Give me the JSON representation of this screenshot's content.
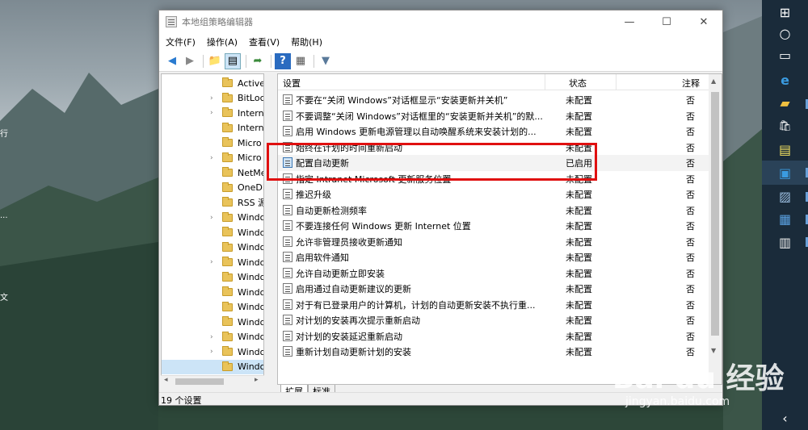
{
  "window": {
    "title": "本地组策略编辑器",
    "min_glyph": "—",
    "max_glyph": "☐",
    "close_glyph": "✕"
  },
  "menu": [
    "文件(F)",
    "操作(A)",
    "查看(V)",
    "帮助(H)"
  ],
  "toolbar": {
    "icons": [
      "back-icon",
      "forward-icon",
      "up-folder-icon",
      "show-hide-tree-icon",
      "export-list-icon",
      "help-icon",
      "properties-icon",
      "filter-icon"
    ],
    "glyphs": [
      "◀",
      "▶",
      "📁",
      "▤",
      "➦",
      "?",
      "▦",
      "▼"
    ]
  },
  "tree": {
    "items": [
      {
        "label": "Active",
        "expand": ""
      },
      {
        "label": "BitLoc",
        "expand": "›"
      },
      {
        "label": "Intern",
        "expand": "›"
      },
      {
        "label": "Intern",
        "expand": ""
      },
      {
        "label": "Micro",
        "expand": ""
      },
      {
        "label": "Micro",
        "expand": "›"
      },
      {
        "label": "NetMe",
        "expand": ""
      },
      {
        "label": "OneDi",
        "expand": ""
      },
      {
        "label": "RSS 源",
        "expand": ""
      },
      {
        "label": "Windo",
        "expand": "›"
      },
      {
        "label": "Windo",
        "expand": ""
      },
      {
        "label": "Windo",
        "expand": ""
      },
      {
        "label": "Windo",
        "expand": "›"
      },
      {
        "label": "Windo",
        "expand": ""
      },
      {
        "label": "Windo",
        "expand": ""
      },
      {
        "label": "Windo",
        "expand": ""
      },
      {
        "label": "Windo",
        "expand": ""
      },
      {
        "label": "Windo",
        "expand": "›"
      },
      {
        "label": "Windo",
        "expand": "›"
      },
      {
        "label": "Windo",
        "expand": ""
      }
    ],
    "selected_index": 19
  },
  "list": {
    "headers": {
      "setting": "设置",
      "state": "状态",
      "note": "注释"
    },
    "rows": [
      {
        "name": "不要在“关闭 Windows”对话框显示“安装更新并关机”",
        "state": "未配置",
        "note": "否",
        "enabled": false
      },
      {
        "name": "不要调整“关闭 Windows”对话框里的“安装更新并关机”的默...",
        "state": "未配置",
        "note": "否",
        "enabled": false
      },
      {
        "name": "启用 Windows 更新电源管理以自动唤醒系统来安装计划的...",
        "state": "未配置",
        "note": "否",
        "enabled": false
      },
      {
        "name": "始终在计划的时间重新启动",
        "state": "未配置",
        "note": "否",
        "enabled": false
      },
      {
        "name": "配置自动更新",
        "state": "已启用",
        "note": "否",
        "enabled": true
      },
      {
        "name": "指定 Intranet Microsoft 更新服务位置",
        "state": "未配置",
        "note": "否",
        "enabled": false
      },
      {
        "name": "推迟升级",
        "state": "未配置",
        "note": "否",
        "enabled": false
      },
      {
        "name": "自动更新检测频率",
        "state": "未配置",
        "note": "否",
        "enabled": false
      },
      {
        "name": "不要连接任何 Windows 更新 Internet 位置",
        "state": "未配置",
        "note": "否",
        "enabled": false
      },
      {
        "name": "允许非管理员接收更新通知",
        "state": "未配置",
        "note": "否",
        "enabled": false
      },
      {
        "name": "启用软件通知",
        "state": "未配置",
        "note": "否",
        "enabled": false
      },
      {
        "name": "允许自动更新立即安装",
        "state": "未配置",
        "note": "否",
        "enabled": false
      },
      {
        "name": "启用通过自动更新建议的更新",
        "state": "未配置",
        "note": "否",
        "enabled": false
      },
      {
        "name": "对于有已登录用户的计算机，计划的自动更新安装不执行重...",
        "state": "未配置",
        "note": "否",
        "enabled": false
      },
      {
        "name": "对计划的安装再次提示重新启动",
        "state": "未配置",
        "note": "否",
        "enabled": false
      },
      {
        "name": "对计划的安装延迟重新启动",
        "state": "未配置",
        "note": "否",
        "enabled": false
      },
      {
        "name": "重新计划自动更新计划的安装",
        "state": "未配置",
        "note": "否",
        "enabled": false
      }
    ],
    "highlighted_index": 4
  },
  "tabs": [
    "扩展",
    "标准"
  ],
  "status": "19 个设置",
  "desktop": {
    "left_labels": [
      "行",
      "...",
      "文"
    ]
  },
  "taskbar": {
    "icons": [
      "windows-start-icon",
      "cortana-icon",
      "task-view-icon",
      "edge-icon",
      "file-explorer-icon",
      "store-icon",
      "sticky-notes-icon",
      "app-icon",
      "photos-icon",
      "outlook-icon",
      "notepad-icon",
      "chevron-left-icon"
    ],
    "glyphs": [
      "⊞",
      "○",
      "▭",
      "e",
      "▰",
      "🛍",
      "▤",
      "▣",
      "▨",
      "▦",
      "▥",
      "‹"
    ]
  },
  "watermark": {
    "brand": "Bai du 经验",
    "url": "jingyan.baidu.com"
  },
  "colors": {
    "highlight_border": "#e01010",
    "selected_tree": "#cce4f7",
    "taskbar": "#1a2b3a"
  }
}
